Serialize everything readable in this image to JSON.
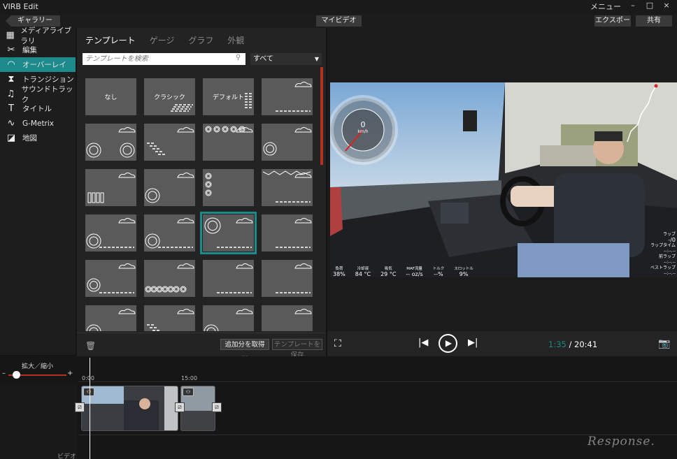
{
  "app": {
    "title": "VIRB Edit",
    "menu_label": "メニュー",
    "minimize": "–",
    "maximize": "□",
    "close": "×"
  },
  "toolbar": {
    "gallery": "ギャラリー",
    "my_video": "マイビデオ",
    "export": "エクスポート",
    "share": "共有"
  },
  "sidebar": {
    "items": [
      {
        "label": "メディアライブラリ",
        "icon": "film-icon",
        "glyph": "▦"
      },
      {
        "label": "編集",
        "icon": "scissors-icon",
        "glyph": "✂"
      },
      {
        "label": "オーバーレイ",
        "icon": "gauge-icon",
        "glyph": "◠"
      },
      {
        "label": "トランジション",
        "icon": "transition-icon",
        "glyph": "⧗"
      },
      {
        "label": "サウンドトラック",
        "icon": "music-icon",
        "glyph": "♫"
      },
      {
        "label": "タイトル",
        "icon": "title-icon",
        "glyph": "T"
      },
      {
        "label": "G-Metrix",
        "icon": "gmetrix-icon",
        "glyph": "∿"
      },
      {
        "label": "地図",
        "icon": "map-icon",
        "glyph": "◪"
      }
    ],
    "active_index": 2
  },
  "templates": {
    "tabs": [
      "テンプレート",
      "ゲージ",
      "グラフ",
      "外観"
    ],
    "active_tab": 0,
    "search_placeholder": "テンプレートを検索",
    "filter_value": "すべて",
    "tiles": [
      {
        "label": "なし"
      },
      {
        "label": "クラシック"
      },
      {
        "label": "デフォルト"
      },
      {
        "label": ""
      },
      {
        "label": ""
      },
      {
        "label": ""
      },
      {
        "label": ""
      },
      {
        "label": ""
      },
      {
        "label": ""
      },
      {
        "label": ""
      },
      {
        "label": ""
      },
      {
        "label": ""
      },
      {
        "label": ""
      },
      {
        "label": ""
      },
      {
        "label": ""
      },
      {
        "label": ""
      },
      {
        "label": ""
      },
      {
        "label": ""
      },
      {
        "label": ""
      },
      {
        "label": ""
      },
      {
        "label": ""
      },
      {
        "label": ""
      },
      {
        "label": ""
      },
      {
        "label": ""
      }
    ],
    "selected_index": 14,
    "get_more": "追加分を取得 ...",
    "save_template": "テンプレートを保存"
  },
  "player": {
    "current_time": "1:35",
    "separator": " / ",
    "duration": "20:41"
  },
  "overlay_stats": {
    "speed_value": "0",
    "speed_unit": "km/h",
    "lap_label": "ラップ",
    "lap_value": "-/0",
    "laptime_label": "ラップタイム",
    "prevlap_label": "前ラップ",
    "bestlap_label": "ベストラップ",
    "dash": "--:--.--",
    "bottom": [
      {
        "label": "負荷",
        "value": "38%"
      },
      {
        "label": "冷却液",
        "value": "84 °C"
      },
      {
        "label": "吸気",
        "value": "29 °C"
      },
      {
        "label": "MAF流量",
        "value": "-- oz/s"
      },
      {
        "label": "トルク",
        "value": "--%"
      },
      {
        "label": "スロットル",
        "value": "9%"
      }
    ]
  },
  "timeline": {
    "zoom_label": "拡大／縮小",
    "zoom_minus": "–",
    "zoom_plus": "+",
    "zoom_level": 0.14,
    "ticks": [
      "0:00",
      "15:00"
    ],
    "track_label": "ビデオ"
  },
  "watermark": "Response."
}
